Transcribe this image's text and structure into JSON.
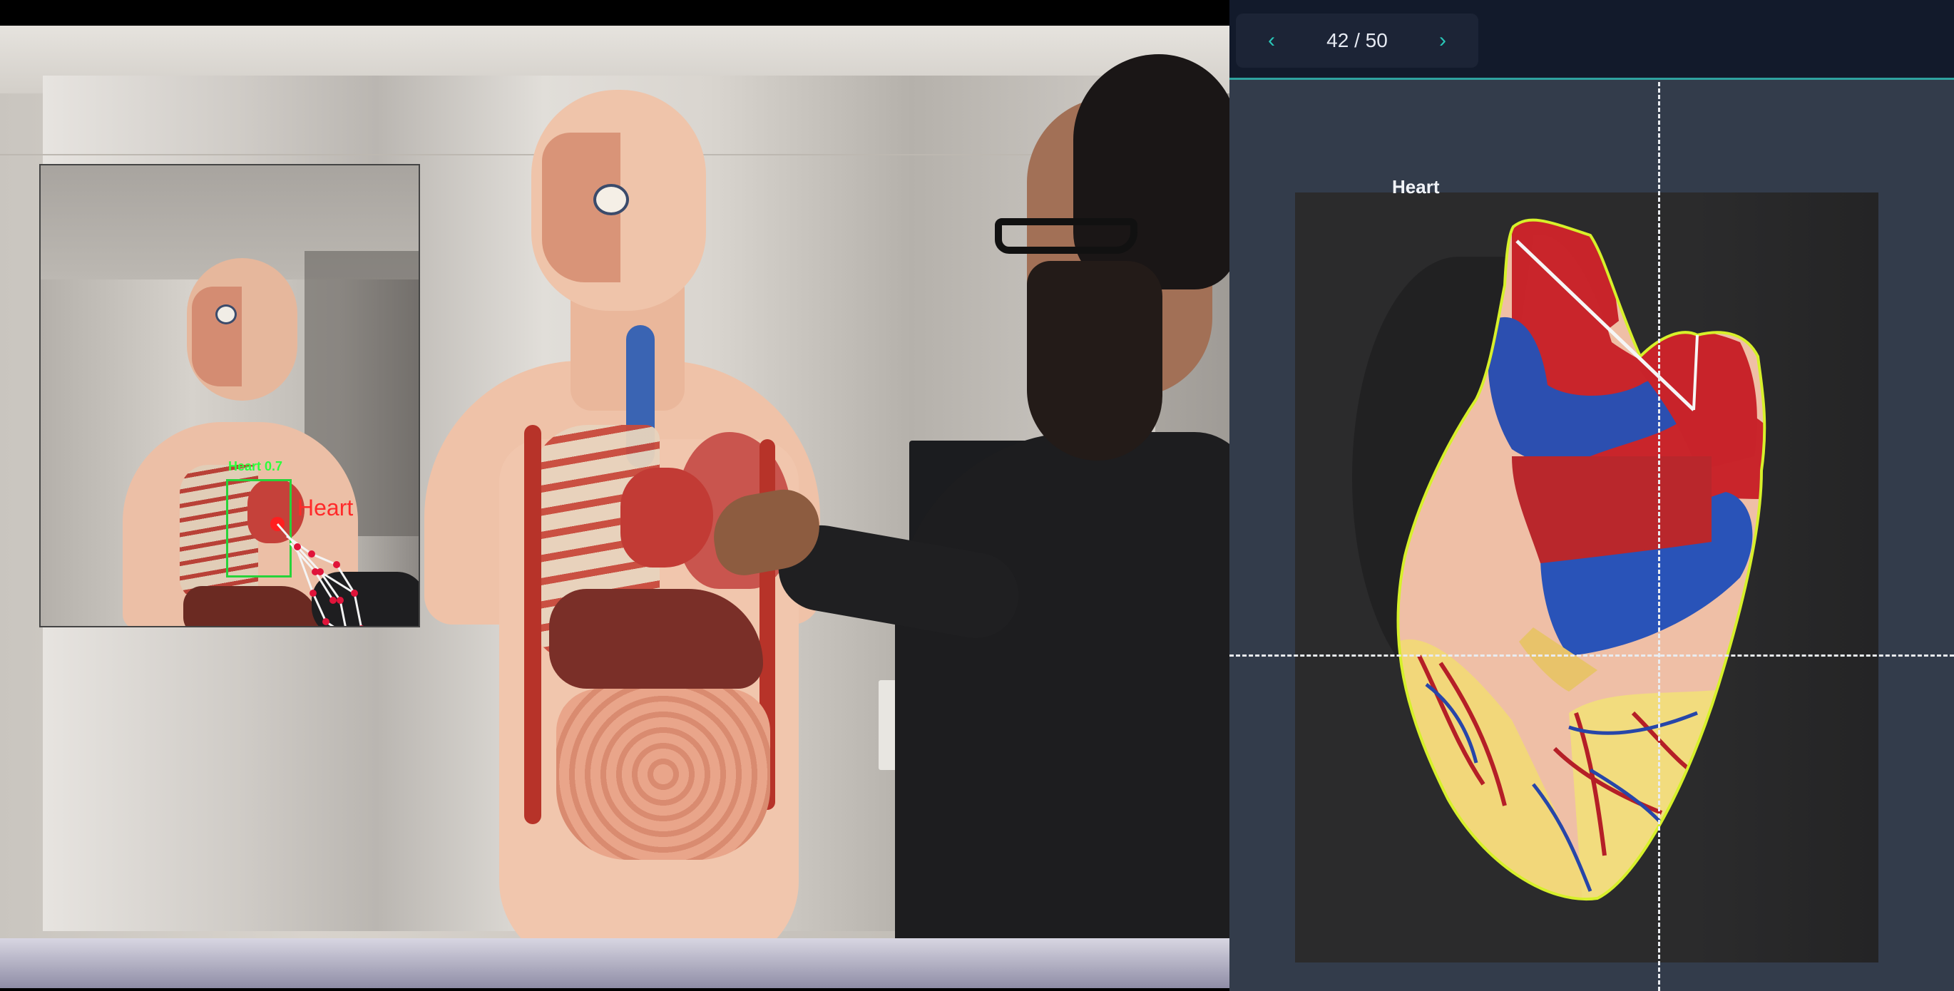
{
  "pager": {
    "prev_icon": "chevron-left-icon",
    "next_icon": "chevron-right-icon",
    "prev_glyph": "‹",
    "next_glyph": "›",
    "counter": "42 / 50"
  },
  "annotation": {
    "label": "Heart",
    "outline_color": "#d7f02a",
    "crosshair_color": "#e9ecf0"
  },
  "inset": {
    "detection_label": "Heart 0.7",
    "pointer_label": "Heart",
    "box_color": "#27d33a",
    "pointer_color": "#ff2a2a"
  },
  "theme": {
    "accent": "#29c7b8",
    "header_bg": "#121a2b",
    "panel_bg": "#333c4b"
  }
}
